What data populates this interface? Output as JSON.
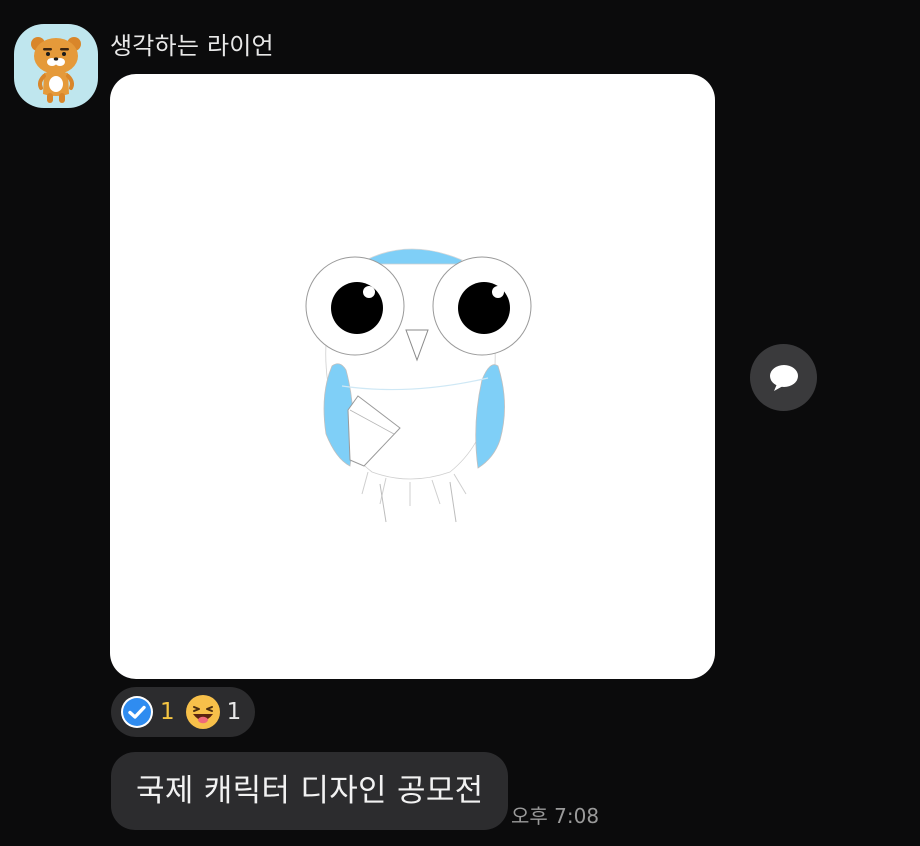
{
  "sender": {
    "name": "생각하는 라이언",
    "avatar_icon": "ryan-character-avatar"
  },
  "message": {
    "image_content": "owl-character-illustration",
    "text": "국제 캐릭터 디자인 공모전",
    "timestamp": "오후 7:08"
  },
  "reactions": [
    {
      "icon": "check-reaction-icon",
      "count": "1",
      "count_color": "#f5c542"
    },
    {
      "icon": "grinning-tongue-emoji-icon",
      "count": "1",
      "count_color": "#e8e8e8"
    }
  ],
  "actions": {
    "comment_icon": "comment-bubble-icon"
  },
  "colors": {
    "background": "#0b0b0c",
    "bubble": "#2c2c2e",
    "owl_accent": "#7fcff7",
    "check_accent": "#2f8cf0"
  }
}
